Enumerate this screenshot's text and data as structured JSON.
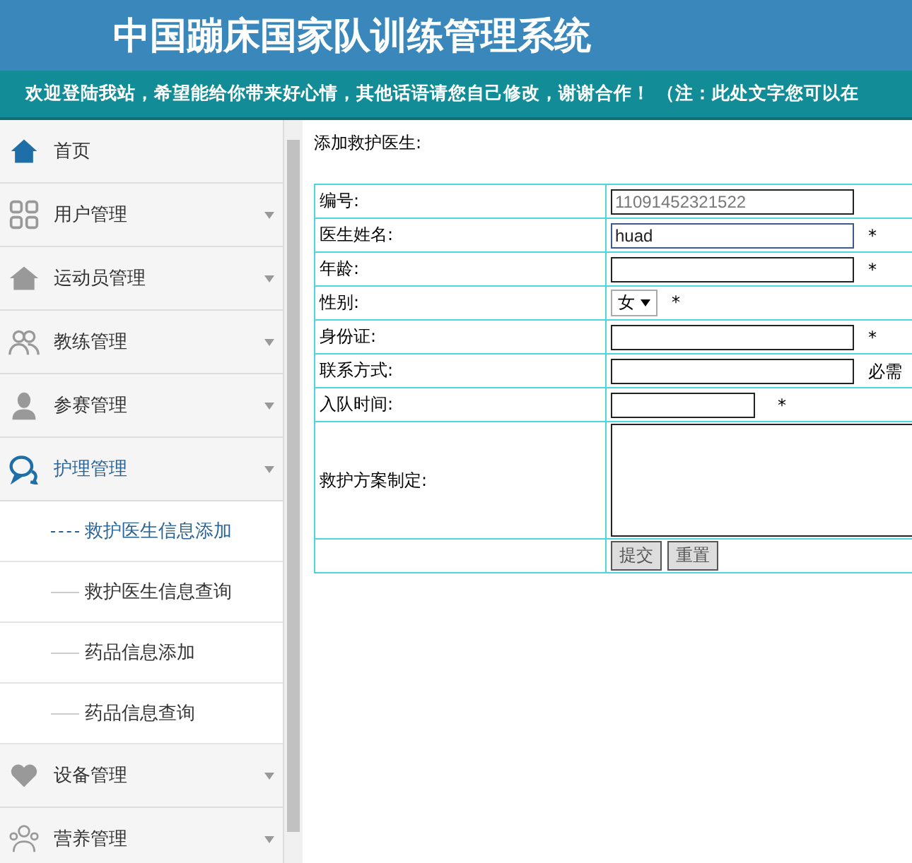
{
  "header": {
    "title": "中国蹦床国家队训练管理系统"
  },
  "banner": {
    "text": "欢迎登陆我站，希望能给你带来好心情，其他话语请您自己修改，谢谢合作！ （注：此处文字您可以在"
  },
  "sidebar": {
    "items": [
      {
        "label": "首页",
        "expanded": false,
        "has_caret": false
      },
      {
        "label": "用户管理",
        "expanded": false,
        "has_caret": true
      },
      {
        "label": "运动员管理",
        "expanded": false,
        "has_caret": true
      },
      {
        "label": "教练管理",
        "expanded": false,
        "has_caret": true
      },
      {
        "label": "参赛管理",
        "expanded": false,
        "has_caret": true
      },
      {
        "label": "护理管理",
        "expanded": true,
        "has_caret": true,
        "children": [
          {
            "label": "救护医生信息添加",
            "selected": true
          },
          {
            "label": "救护医生信息查询",
            "selected": false
          },
          {
            "label": "药品信息添加",
            "selected": false
          },
          {
            "label": "药品信息查询",
            "selected": false
          }
        ]
      },
      {
        "label": "设备管理",
        "expanded": false,
        "has_caret": true
      },
      {
        "label": "营养管理",
        "expanded": false,
        "has_caret": true
      }
    ]
  },
  "form": {
    "title": "添加救护医生:",
    "rows": [
      {
        "kind": "text",
        "label": "编号:",
        "value": "11091452321522",
        "readonly": true
      },
      {
        "kind": "text",
        "label": "医生姓名:",
        "value": "huad",
        "required": "*",
        "focused": true
      },
      {
        "kind": "text",
        "label": "年龄:",
        "required": "*"
      },
      {
        "kind": "select",
        "label": "性别:",
        "value": "女",
        "required": "*"
      },
      {
        "kind": "text",
        "label": "身份证:",
        "required": "*"
      },
      {
        "kind": "text",
        "label": "联系方式:",
        "required": "必需"
      },
      {
        "kind": "short",
        "label": "入队时间:",
        "required": "*"
      },
      {
        "kind": "textarea",
        "label": "救护方案制定:"
      }
    ],
    "buttons": [
      "提交",
      "重置"
    ]
  }
}
